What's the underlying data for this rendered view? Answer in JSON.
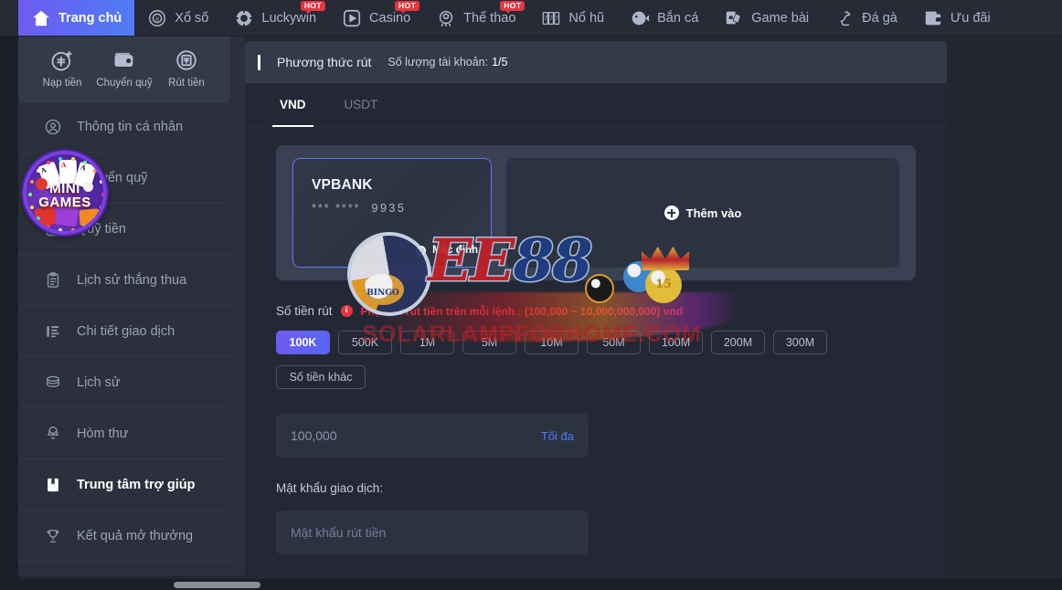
{
  "topnav": {
    "items": [
      {
        "label": "Trang chủ",
        "icon": "home-icon",
        "active": true,
        "hot": false
      },
      {
        "label": "Xổ số",
        "icon": "lottery-ball-icon",
        "active": false,
        "hot": false
      },
      {
        "label": "Luckywin",
        "icon": "poker-chip-icon",
        "active": false,
        "hot": true
      },
      {
        "label": "Casino",
        "icon": "play-circle-icon",
        "active": false,
        "hot": true
      },
      {
        "label": "Thể thao",
        "icon": "soccer-ball-icon",
        "active": false,
        "hot": true
      },
      {
        "label": "Nổ hũ",
        "icon": "slot-777-icon",
        "active": false,
        "hot": false
      },
      {
        "label": "Bắn cá",
        "icon": "fish-icon",
        "active": false,
        "hot": false
      },
      {
        "label": "Game bài",
        "icon": "playing-cards-icon",
        "active": false,
        "hot": false
      },
      {
        "label": "Đá gà",
        "icon": "rooster-icon",
        "active": false,
        "hot": false
      },
      {
        "label": "Ưu đãi",
        "icon": "gift-wallet-icon",
        "active": false,
        "hot": false
      }
    ],
    "hot_label": "HOT"
  },
  "sidebar": {
    "quick_actions": [
      {
        "label": "Nạp tiền",
        "icon": "deposit-coin-icon"
      },
      {
        "label": "Chuyển quỹ",
        "icon": "wallet-transfer-icon"
      },
      {
        "label": "Rút tiền",
        "icon": "withdraw-atm-icon"
      }
    ],
    "items": [
      {
        "label": "Thông tin cá nhân",
        "icon": "user-circle-icon",
        "active": false
      },
      {
        "label": "Chuyển quỹ",
        "icon": "transfer-icon",
        "active": false
      },
      {
        "label": "Quỹ tiền",
        "icon": "fund-note-icon",
        "active": false
      },
      {
        "label": "Lịch sử thắng thua",
        "icon": "clipboard-icon",
        "active": false
      },
      {
        "label": "Chi tiết giao dịch",
        "icon": "bars-list-icon",
        "active": false
      },
      {
        "label": "Lịch sử",
        "icon": "coins-stack-icon",
        "active": false
      },
      {
        "label": "Hòm thư",
        "icon": "bell-mail-icon",
        "active": false
      },
      {
        "label": "Trung tâm trợ giúp",
        "icon": "book-icon",
        "active": true
      },
      {
        "label": "Kết quả mở thưởng",
        "icon": "trophy-icon",
        "active": false
      }
    ],
    "minigames_badge": {
      "line1": "MINI",
      "line2": "GAMES",
      "card_ranks": [
        "A",
        "A",
        "A"
      ]
    }
  },
  "panel": {
    "title": "Phương thức rút",
    "account_count_label": "Số lượng tài khoản:",
    "account_count_value": "1/5",
    "tabs": [
      {
        "label": "VND",
        "active": true
      },
      {
        "label": "USDT",
        "active": false
      }
    ]
  },
  "bank_card": {
    "name": "VPBANK",
    "masked_groups": "***  ****",
    "last_four": "9935",
    "default_label": "Mặc định",
    "default_selected": true
  },
  "add_card": {
    "label": "Thêm vào",
    "icon": "plus-circle-icon"
  },
  "amount": {
    "label": "Số tiền rút",
    "info_icon": "info-icon",
    "info_glyph": "i",
    "warning": "Phạm vi rút tiền trên mỗi lệnh : (100,000 ~ 10,000,000,000) vnd",
    "chips": [
      {
        "label": "100K",
        "selected": true
      },
      {
        "label": "500K",
        "selected": false
      },
      {
        "label": "1M",
        "selected": false
      },
      {
        "label": "5M",
        "selected": false
      },
      {
        "label": "10M",
        "selected": false
      },
      {
        "label": "50M",
        "selected": false
      },
      {
        "label": "100M",
        "selected": false
      },
      {
        "label": "200M",
        "selected": false
      },
      {
        "label": "300M",
        "selected": false
      }
    ],
    "other_chip": "Số tiền khác",
    "input_value": "100,000",
    "max_label": "Tối đa"
  },
  "password": {
    "label": "Mật khẩu giao dịch:",
    "placeholder": "Mật khẩu rút tiền"
  },
  "watermark": {
    "brand_red": "EE",
    "brand_blue": "88",
    "site": "SOLARLAMPFORHOME.COM",
    "disc_text": "BINGO"
  },
  "colors": {
    "accent_purple": "#6f5bf0",
    "accent_blue": "#4d7cf7",
    "hot_red": "#e8343f",
    "panel_bg": "#232834",
    "sidebar_bg": "#2b303c",
    "page_bg": "#22262f"
  }
}
